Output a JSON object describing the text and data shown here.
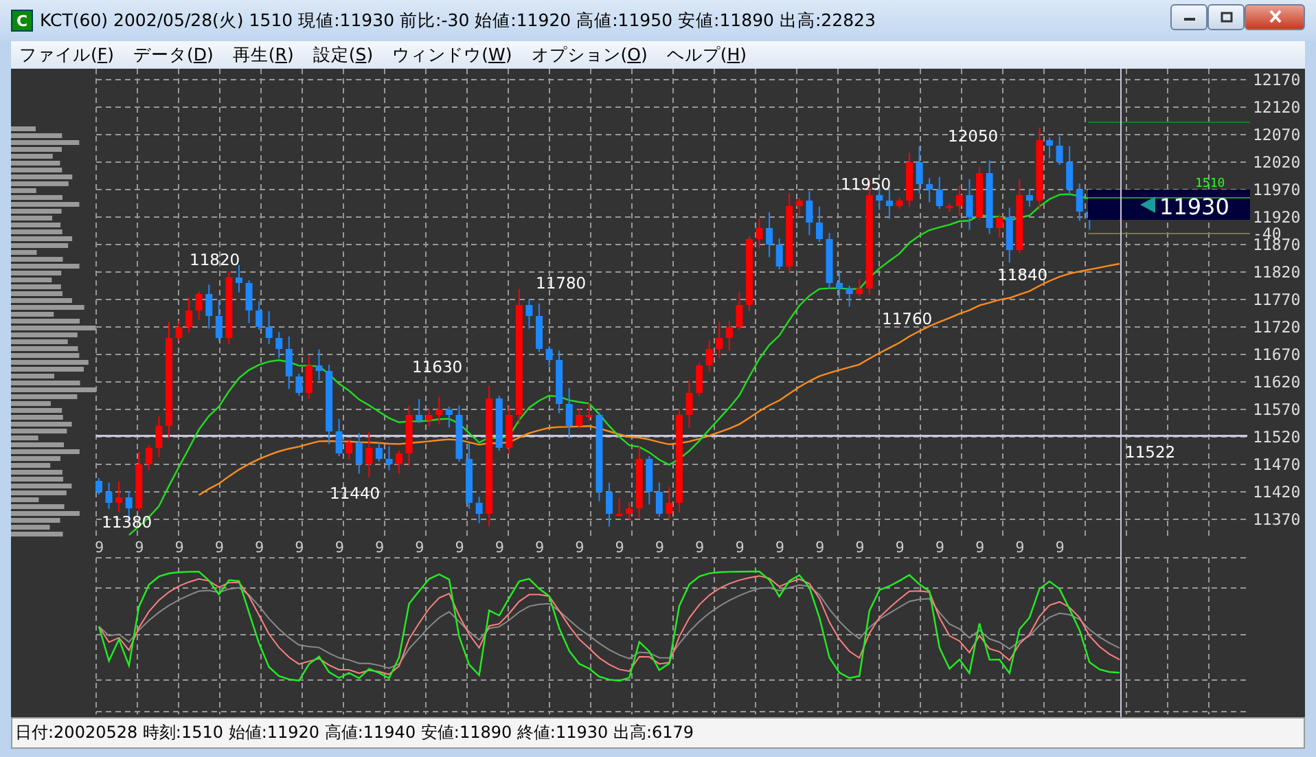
{
  "window": {
    "icon_letter": "C",
    "title": "KCT(60) 2002/05/28(火) 1510 現値:11930 前比:-30  始値:11920 高値:11950 安値:11890 出高:22823"
  },
  "menu": [
    {
      "label": "ファイル(",
      "accel": "F",
      "suffix": ")"
    },
    {
      "label": "データ(",
      "accel": "D",
      "suffix": ")"
    },
    {
      "label": "再生(",
      "accel": "R",
      "suffix": ")"
    },
    {
      "label": "設定(",
      "accel": "S",
      "suffix": ")"
    },
    {
      "label": "ウィンドウ(",
      "accel": "W",
      "suffix": ")"
    },
    {
      "label": "オプション(",
      "accel": "O",
      "suffix": ")"
    },
    {
      "label": "ヘルプ(",
      "accel": "H",
      "suffix": ")"
    }
  ],
  "chart": {
    "price_axis": [
      "12170",
      "12120",
      "12070",
      "12020",
      "11970",
      "11920",
      "11870",
      "11820",
      "11770",
      "11720",
      "11670",
      "11620",
      "11570",
      "11520",
      "11470",
      "11420",
      "11370"
    ],
    "time_axis": [
      "9",
      "9",
      "9",
      "9",
      "9",
      "9",
      "9",
      "9",
      "9",
      "9",
      "9",
      "9",
      "9",
      "9",
      "9",
      "9",
      "9",
      "9",
      "9",
      "9",
      "9",
      "9",
      "9",
      "9",
      "9"
    ],
    "price_labels": [
      "11820",
      "11380",
      "11440",
      "11630",
      "11780",
      "11950",
      "11760",
      "12050",
      "11840"
    ],
    "reference_label": "11522",
    "current": {
      "price": "11930",
      "time": "1510",
      "change": "-40"
    }
  },
  "status_bar": "日付:20020528 時刻:1510 始値:11920 高値:11940 安値:11890 終値:11930 出高:6179"
}
